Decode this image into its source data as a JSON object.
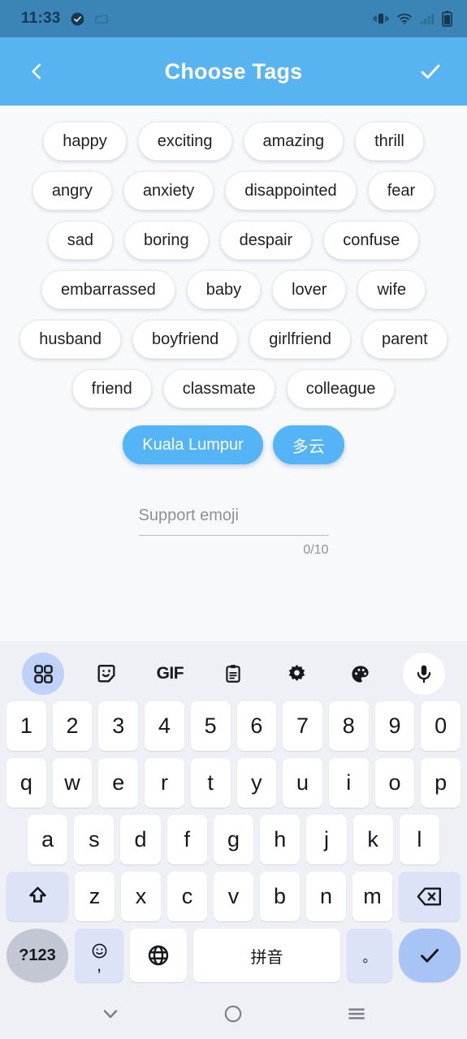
{
  "status_bar": {
    "time": "11:33",
    "icons": [
      "check-circle-icon",
      "bag-icon",
      "vibrate-icon",
      "wifi-icon",
      "signal-icon",
      "battery-icon"
    ]
  },
  "app_bar": {
    "title": "Choose Tags",
    "back_icon": "chevron-left-icon",
    "confirm_icon": "check-icon",
    "background_color": "#57b4f0"
  },
  "tags": {
    "accent_color": "#55b4f5",
    "rows": [
      [
        {
          "label": "happy",
          "selected": false
        },
        {
          "label": "exciting",
          "selected": false
        },
        {
          "label": "amazing",
          "selected": false
        },
        {
          "label": "thrill",
          "selected": false
        }
      ],
      [
        {
          "label": "angry",
          "selected": false
        },
        {
          "label": "anxiety",
          "selected": false
        },
        {
          "label": "disappointed",
          "selected": false
        },
        {
          "label": "fear",
          "selected": false
        }
      ],
      [
        {
          "label": "sad",
          "selected": false
        },
        {
          "label": "boring",
          "selected": false
        },
        {
          "label": "despair",
          "selected": false
        },
        {
          "label": "confuse",
          "selected": false
        }
      ],
      [
        {
          "label": "embarrassed",
          "selected": false
        },
        {
          "label": "baby",
          "selected": false
        },
        {
          "label": "lover",
          "selected": false
        },
        {
          "label": "wife",
          "selected": false
        }
      ],
      [
        {
          "label": "husband",
          "selected": false
        },
        {
          "label": "boyfriend",
          "selected": false
        },
        {
          "label": "girlfriend",
          "selected": false
        },
        {
          "label": "parent",
          "selected": false
        }
      ],
      [
        {
          "label": "friend",
          "selected": false
        },
        {
          "label": "classmate",
          "selected": false
        },
        {
          "label": "colleague",
          "selected": false
        }
      ]
    ],
    "selected_row": [
      {
        "label": "Kuala Lumpur",
        "selected": true
      },
      {
        "label": "多云",
        "selected": true
      }
    ]
  },
  "input": {
    "value": "",
    "placeholder": "Support emoji",
    "counter": "0/10"
  },
  "keyboard": {
    "toolbar": [
      {
        "icon": "grid-icon",
        "active": true
      },
      {
        "icon": "sticker-icon",
        "active": false
      },
      {
        "icon": "gif-icon",
        "label": "GIF",
        "active": false
      },
      {
        "icon": "clipboard-icon",
        "active": false
      },
      {
        "icon": "gear-icon",
        "active": false
      },
      {
        "icon": "palette-icon",
        "active": false
      },
      {
        "icon": "microphone-icon",
        "active": false
      }
    ],
    "row_numbers": [
      "1",
      "2",
      "3",
      "4",
      "5",
      "6",
      "7",
      "8",
      "9",
      "0"
    ],
    "row_top": [
      "q",
      "w",
      "e",
      "r",
      "t",
      "y",
      "u",
      "i",
      "o",
      "p"
    ],
    "row_home": [
      "a",
      "s",
      "d",
      "f",
      "g",
      "h",
      "j",
      "k",
      "l"
    ],
    "row_bottom": [
      "z",
      "x",
      "c",
      "v",
      "b",
      "n",
      "m"
    ],
    "shift_icon": "shift-icon",
    "backspace_icon": "backspace-icon",
    "symbols_label": "?123",
    "emoji_icon": "emoji-icon",
    "comma_label": ",",
    "globe_icon": "globe-icon",
    "space_label": "拼音",
    "period_label": "。",
    "enter_icon": "check-icon"
  },
  "nav_bar": {
    "back_icon": "chevron-down-icon",
    "home_icon": "circle-icon",
    "recents_icon": "menu-icon"
  }
}
